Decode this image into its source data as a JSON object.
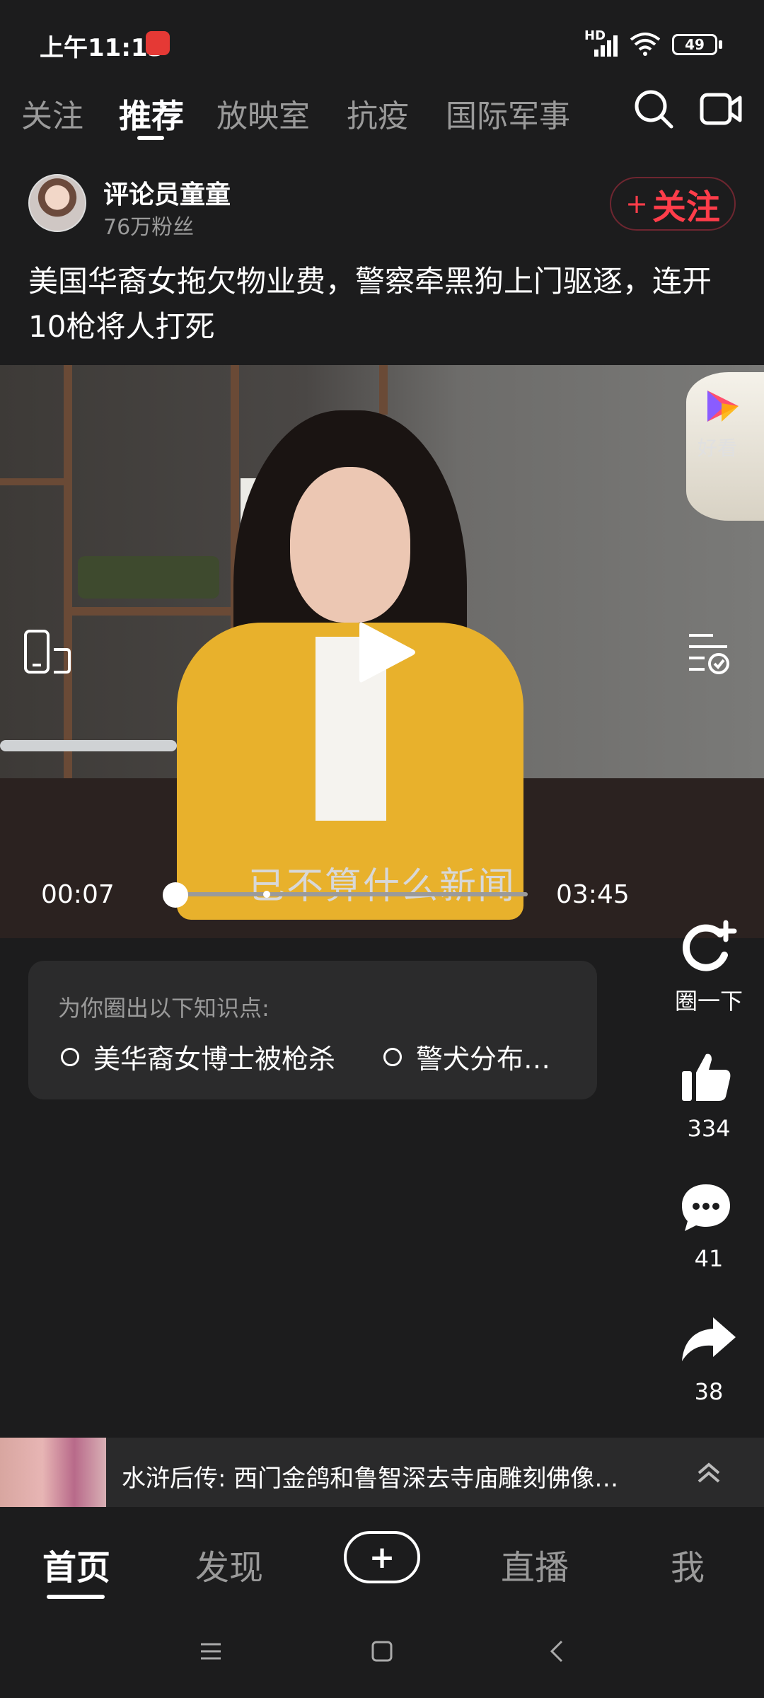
{
  "status_bar": {
    "time": "上午11:13",
    "network_label": "HD",
    "battery": "49"
  },
  "top_tabs": [
    {
      "label": "关注",
      "active": false
    },
    {
      "label": "推荐",
      "active": true
    },
    {
      "label": "放映室",
      "active": false
    },
    {
      "label": "抗疫",
      "active": false
    },
    {
      "label": "国际军事",
      "active": false
    }
  ],
  "author": {
    "name": "评论员童童",
    "fans": "76万粉丝",
    "follow_label": "关注"
  },
  "post": {
    "title": "美国华裔女拖欠物业费，警察牵黑狗上门驱逐，连开10枪将人打死"
  },
  "video": {
    "subtitle": "已不算什么新闻",
    "current_time": "00:07",
    "total_time": "03:45",
    "progress": 0.031,
    "brand_label": "好看"
  },
  "knowledge": {
    "title": "为你圈出以下知识点:",
    "points": [
      "美华裔女博士被枪杀",
      "警犬分布…"
    ]
  },
  "actions": {
    "circle_label": "圈一下",
    "likes": "334",
    "comments": "41",
    "shares": "38"
  },
  "related": {
    "title": "水浒后传: 西门金鸽和鲁智深去寺庙雕刻佛像…"
  },
  "bottom_nav": [
    {
      "label": "首页",
      "active": true
    },
    {
      "label": "发现",
      "active": false
    },
    {
      "label": "直播",
      "active": false
    },
    {
      "label": "我",
      "active": false
    }
  ]
}
